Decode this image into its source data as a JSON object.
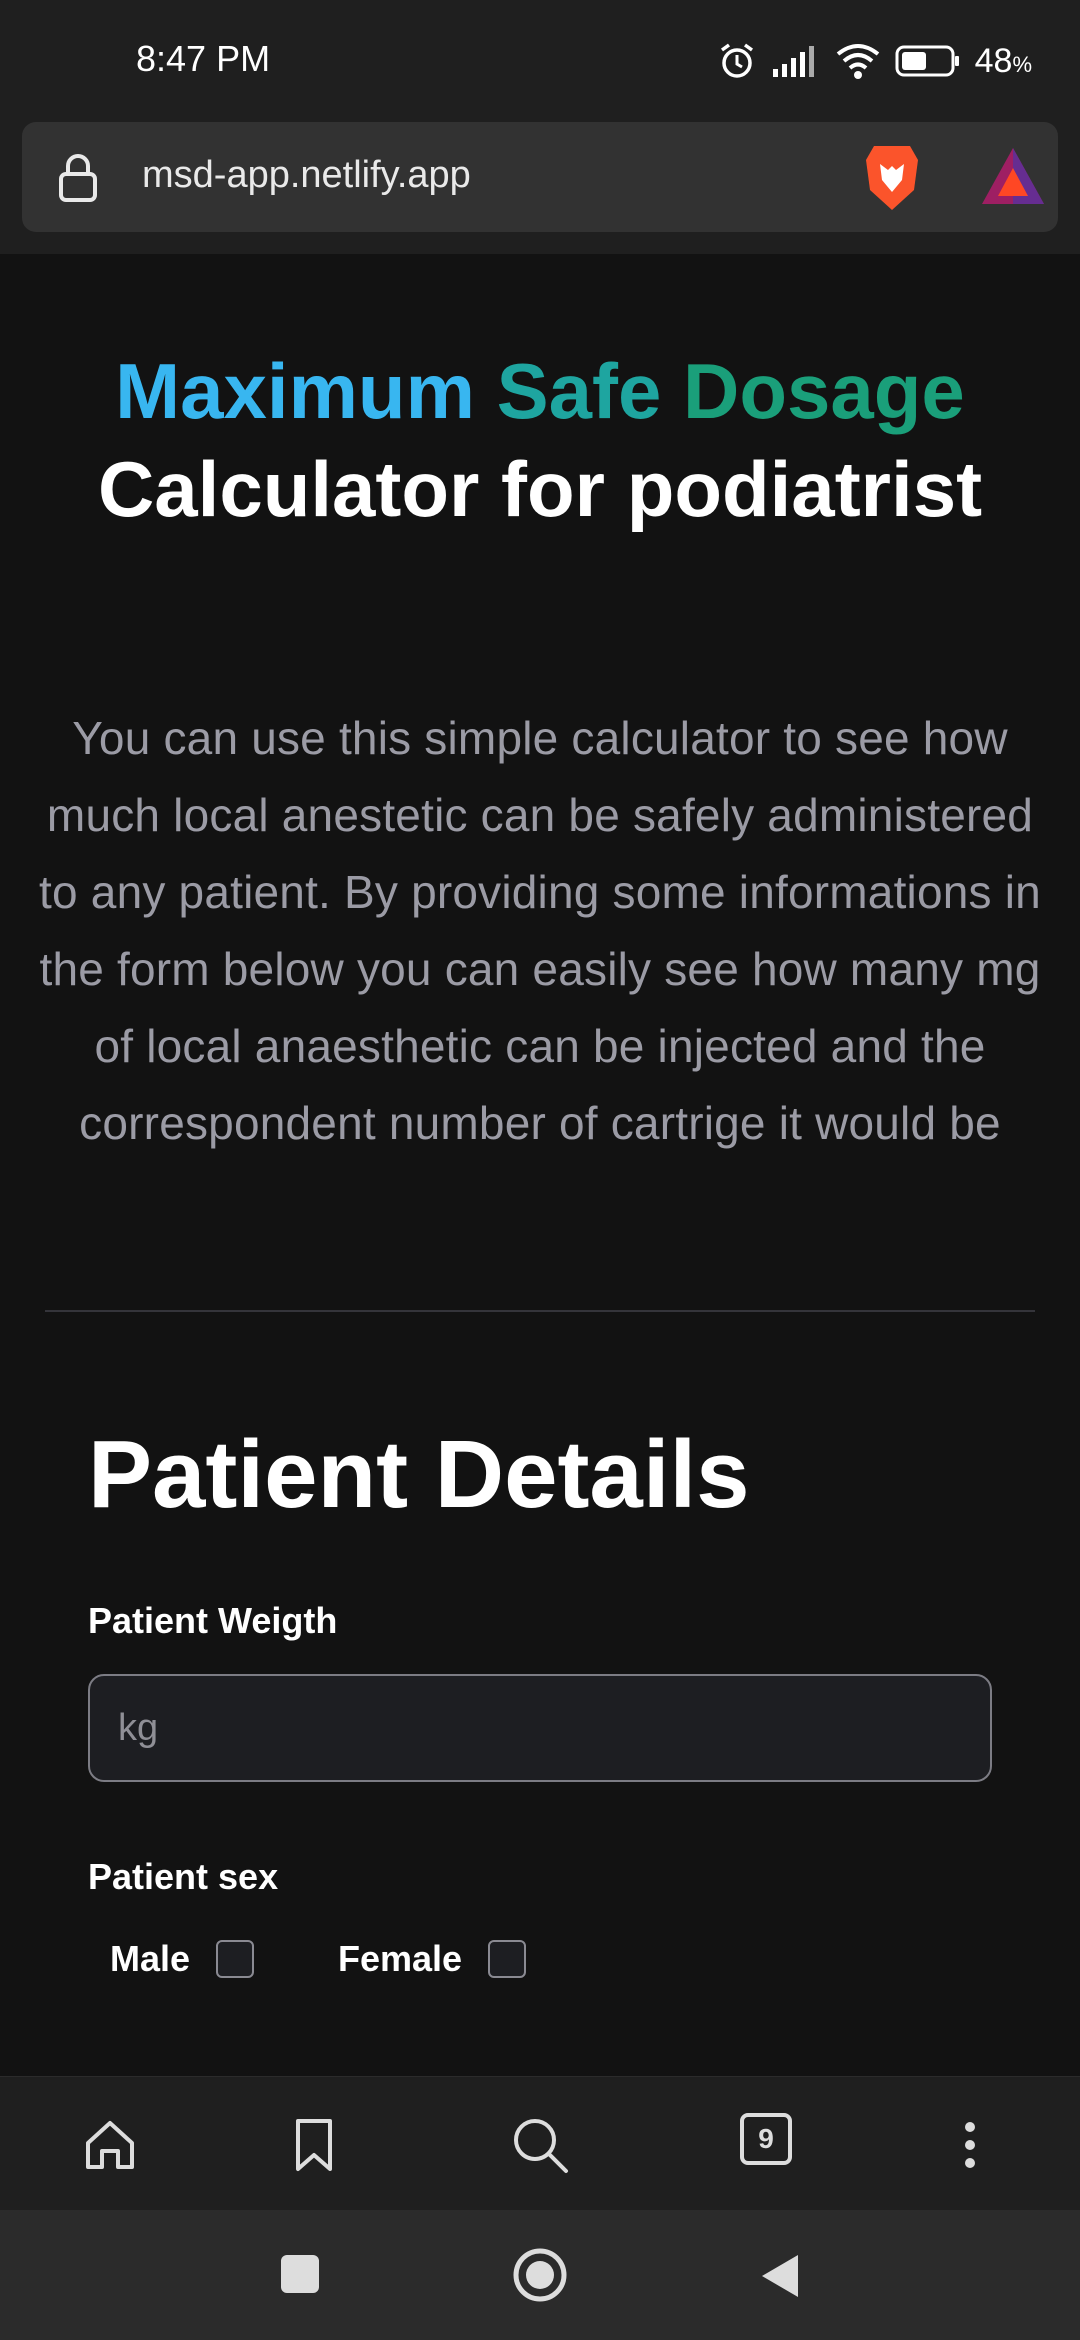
{
  "status_bar": {
    "time": "8:47 PM",
    "battery_percent": "48",
    "battery_symbol": "%"
  },
  "browser": {
    "url": "msd-app.netlify.app",
    "tab_count": "9"
  },
  "page": {
    "title_word_1": "Maximum",
    "title_word_2": "Safe",
    "title_word_3": "Dosage",
    "title_line_2": "Calculator for podiatrist",
    "intro_lines": [
      "You can use this simple calculator to see how",
      "much local anestetic can be safely administered",
      "to any patient. By providing some informations in",
      "the form below you can easily see how many mg",
      "of local anaesthetic can be injected and the",
      "correspondent number of cartrige it would be"
    ],
    "section_heading": "Patient Details",
    "weight_label": "Patient Weigth",
    "weight_placeholder": "kg",
    "weight_value": "",
    "sex_label": "Patient sex",
    "sex_options": [
      "Male",
      "Female"
    ]
  },
  "colors": {
    "title_maximum": "#38b6f0",
    "title_safe": "#1ea5a0",
    "title_dosage": "#1a9f7a",
    "background": "#121212"
  },
  "icons": {
    "bottom_nav": [
      "home-icon",
      "bookmark-icon",
      "search-icon",
      "tabs-icon",
      "more-icon"
    ],
    "system_nav": [
      "recents-icon",
      "home-circle-icon",
      "back-icon"
    ]
  }
}
